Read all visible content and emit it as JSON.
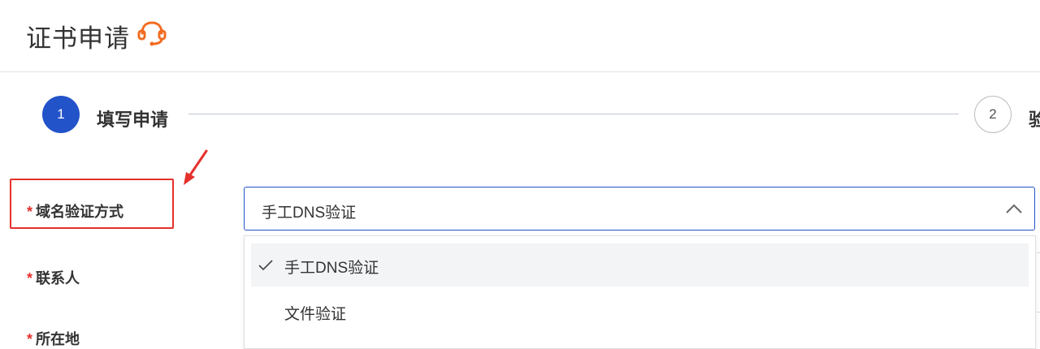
{
  "header": {
    "title": "证书申请",
    "support_icon": "headset-icon",
    "accent_color": "#f26b21"
  },
  "steps": [
    {
      "number": "1",
      "label": "填写申请",
      "state": "active"
    },
    {
      "number": "2",
      "label": "验",
      "state": "pending"
    }
  ],
  "form": {
    "domain_validation": {
      "label": "域名验证方式",
      "required_mark": "*",
      "value": "手工DNS验证",
      "options": [
        {
          "label": "手工DNS验证",
          "selected": true
        },
        {
          "label": "文件验证",
          "selected": false
        }
      ]
    },
    "contact": {
      "label": "联系人",
      "required_mark": "*"
    },
    "third": {
      "label": "所在地",
      "required_mark": "*"
    }
  },
  "annotation": {
    "color": "#e5312c",
    "target": "域名验证方式"
  },
  "colors": {
    "primary": "#2353c9",
    "required": "#e5312c"
  }
}
